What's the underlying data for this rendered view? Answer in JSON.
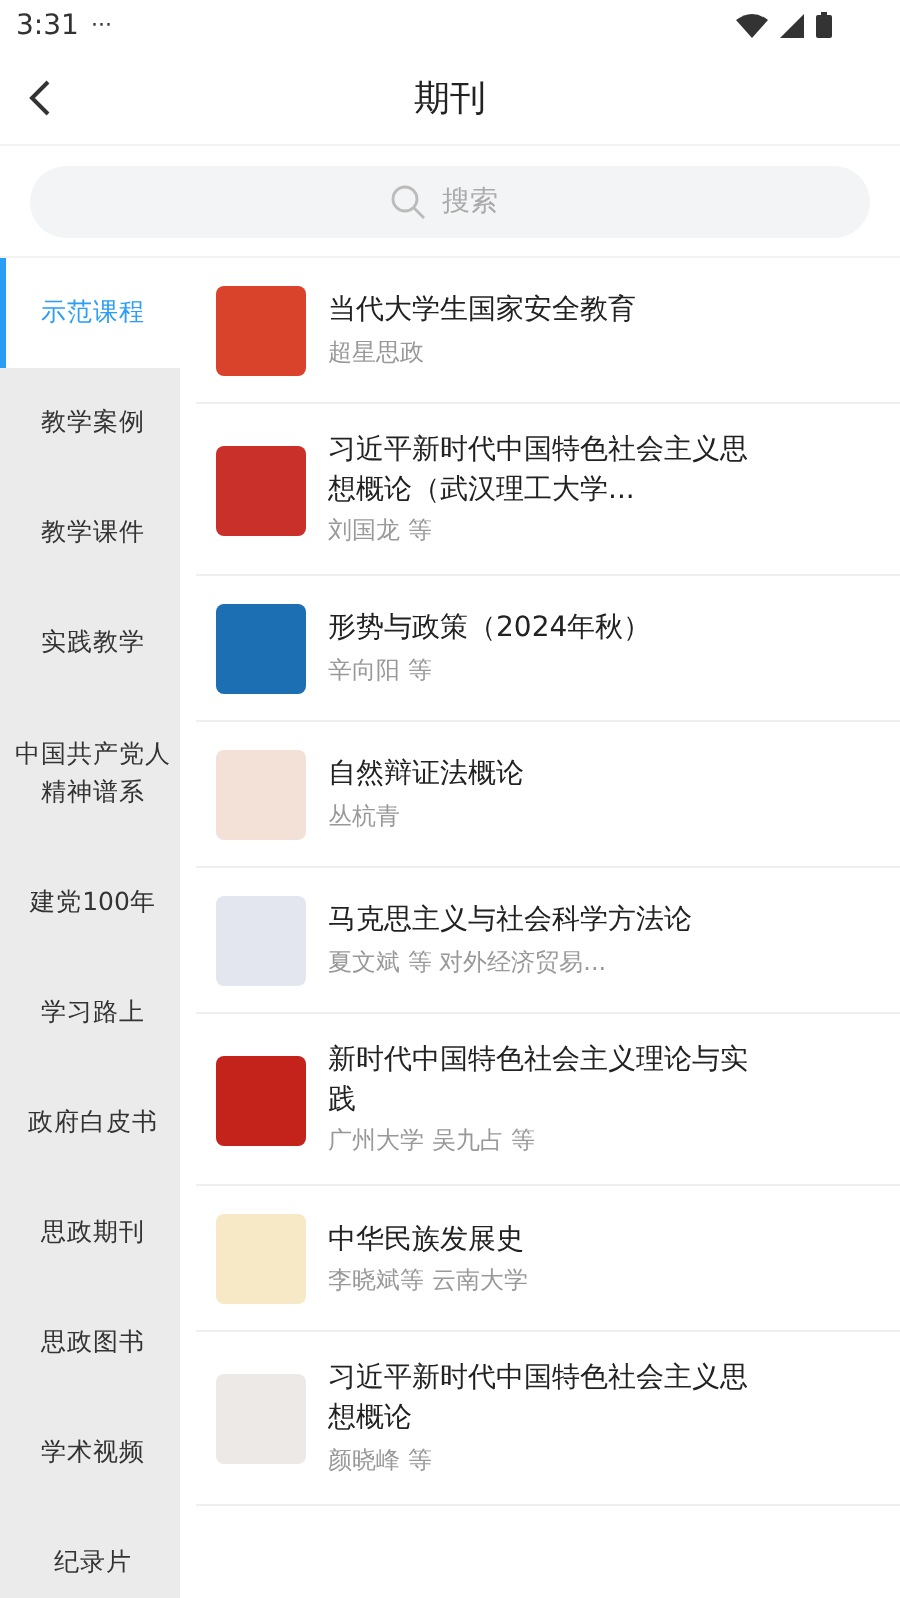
{
  "status_bar": {
    "time": "3:31",
    "dots": "···"
  },
  "header": {
    "title": "期刊"
  },
  "search": {
    "placeholder": "搜索"
  },
  "sidebar": {
    "items": [
      {
        "label": "示范课程",
        "selected": true
      },
      {
        "label": "教学案例",
        "selected": false
      },
      {
        "label": "教学课件",
        "selected": false
      },
      {
        "label": "实践教学",
        "selected": false
      },
      {
        "label": "中国共产党人精神谱系",
        "selected": false
      },
      {
        "label": "建党100年",
        "selected": false
      },
      {
        "label": "学习路上",
        "selected": false
      },
      {
        "label": "政府白皮书",
        "selected": false
      },
      {
        "label": "思政期刊",
        "selected": false
      },
      {
        "label": "思政图书",
        "selected": false
      },
      {
        "label": "学术视频",
        "selected": false
      },
      {
        "label": "纪录片",
        "selected": false
      }
    ]
  },
  "books": [
    {
      "title": "当代大学生国家安全教育",
      "author": "超星思政",
      "color": "#d9432c"
    },
    {
      "title": "习近平新时代中国特色社会主义思想概论（武汉理工大学...",
      "author": "刘国龙 等",
      "color": "#c9302a"
    },
    {
      "title": "形势与政策（2024年秋）",
      "author": "辛向阳 等",
      "color": "#1d6fb3"
    },
    {
      "title": "自然辩证法概论",
      "author": "丛杭青",
      "color": "#f3e1d8"
    },
    {
      "title": "马克思主义与社会科学方法论",
      "author": "夏文斌 等 对外经济贸易...",
      "color": "#e3e6ef"
    },
    {
      "title": "新时代中国特色社会主义理论与实践",
      "author": "广州大学 吴九占 等",
      "color": "#c4231c"
    },
    {
      "title": "中华民族发展史",
      "author": "李晓斌等 云南大学",
      "color": "#f7e8c6"
    },
    {
      "title": "习近平新时代中国特色社会主义思想概论",
      "author": "颜晓峰 等",
      "color": "#ede9e6"
    }
  ]
}
